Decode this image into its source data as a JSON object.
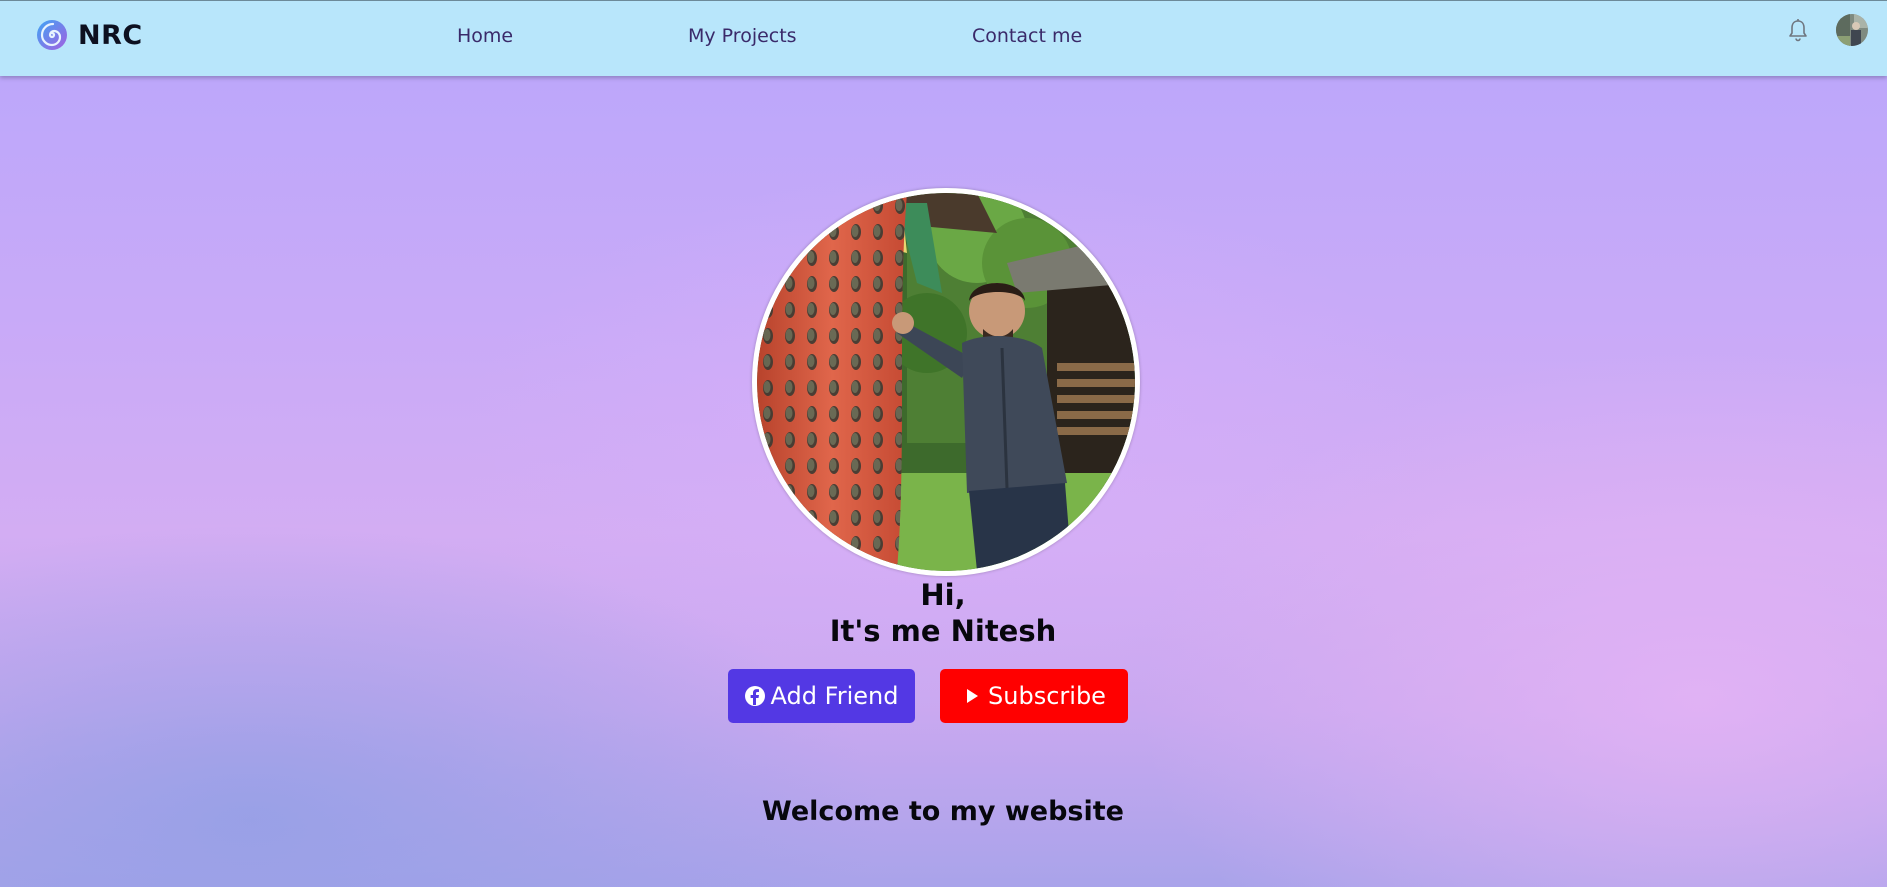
{
  "navbar": {
    "brand": "NRC",
    "links": [
      "Home",
      "My Projects",
      "Contact me"
    ],
    "icons": [
      "spiral-logo-icon",
      "bell-icon",
      "user-avatar"
    ]
  },
  "hero": {
    "greeting_line1": "Hi,",
    "greeting_line2": "It's me Nitesh",
    "add_friend_label": "Add Friend",
    "subscribe_label": "Subscribe",
    "add_friend_icon": "facebook-icon",
    "subscribe_icon": "play-icon"
  },
  "welcome": "Welcome to my website",
  "colors": {
    "navbar_bg": "#b8e6fb",
    "add_friend_bg": "#5338e4",
    "subscribe_bg": "#ff0000",
    "nav_link": "#3a2a6a"
  }
}
